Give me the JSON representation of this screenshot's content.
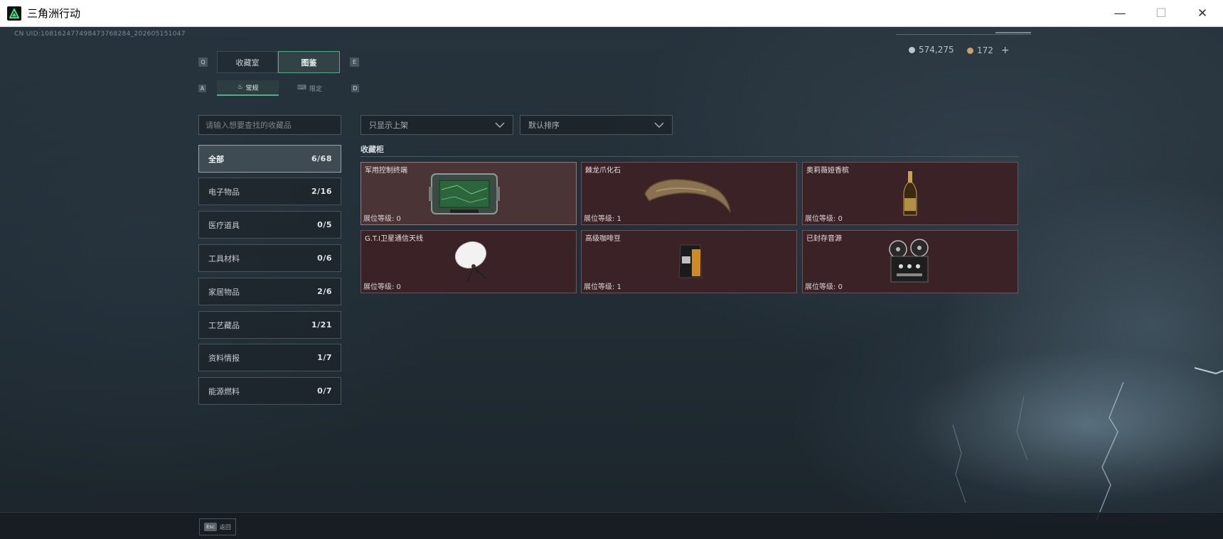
{
  "window": {
    "title": "三角洲行动",
    "controls": {
      "minimize": "—",
      "maximize": "☐",
      "close": "✕"
    }
  },
  "hud": {
    "uid": "CN UID:10816247749847376828­4_202605151047",
    "currency_1": {
      "icon": "silver-coin-icon",
      "value": "574,275"
    },
    "currency_2": {
      "icon": "gold-coin-icon",
      "value": "172",
      "add_label": "+"
    }
  },
  "tabs": {
    "left_key": "Q",
    "right_key": "E",
    "items": [
      {
        "label": "收藏室",
        "active": false
      },
      {
        "label": "图鉴",
        "active": true
      }
    ]
  },
  "subtabs": {
    "left_key": "A",
    "right_key": "D",
    "items": [
      {
        "label": "常规",
        "icon": "flame-icon",
        "active": true
      },
      {
        "label": "限定",
        "icon": "gamepad-icon",
        "active": false
      }
    ]
  },
  "search": {
    "placeholder": "请输入想要查找的收藏品",
    "value": ""
  },
  "filters": {
    "display": {
      "selected": "只显示上架"
    },
    "sort": {
      "selected": "默认排序"
    }
  },
  "categories": [
    {
      "label": "全部",
      "count": "6/68",
      "active": true
    },
    {
      "label": "电子物品",
      "count": "2/16",
      "active": false
    },
    {
      "label": "医疗道具",
      "count": "0/5",
      "active": false
    },
    {
      "label": "工具材料",
      "count": "0/6",
      "active": false
    },
    {
      "label": "家居物品",
      "count": "2/6",
      "active": false
    },
    {
      "label": "工艺藏品",
      "count": "1/21",
      "active": false
    },
    {
      "label": "资料情报",
      "count": "1/7",
      "active": false
    },
    {
      "label": "能源燃料",
      "count": "0/7",
      "active": false
    }
  ],
  "shelf": {
    "title": "收藏柜",
    "items": [
      {
        "name": "军用控制终端",
        "level": "展位等级: 0",
        "icon": "tablet-icon"
      },
      {
        "name": "棘龙爪化石",
        "level": "展位等级: 1",
        "icon": "claw-fossil-icon"
      },
      {
        "name": "奥莉薇娅香槟",
        "level": "展位等级: 0",
        "icon": "champagne-bottle-icon"
      },
      {
        "name": "G.T.I卫星通信天线",
        "level": "展位等级: 0",
        "icon": "satellite-dish-icon"
      },
      {
        "name": "高级咖啡豆",
        "level": "展位等级: 1",
        "icon": "coffee-bag-icon"
      },
      {
        "name": "已封存音源",
        "level": "展位等级: 0",
        "icon": "reel-recorder-icon"
      }
    ]
  },
  "footer": {
    "key": "Esc",
    "label": "返回"
  },
  "colors": {
    "accent": "#4fae86",
    "card_bg": "#3b2226",
    "background": "#1e2830"
  }
}
